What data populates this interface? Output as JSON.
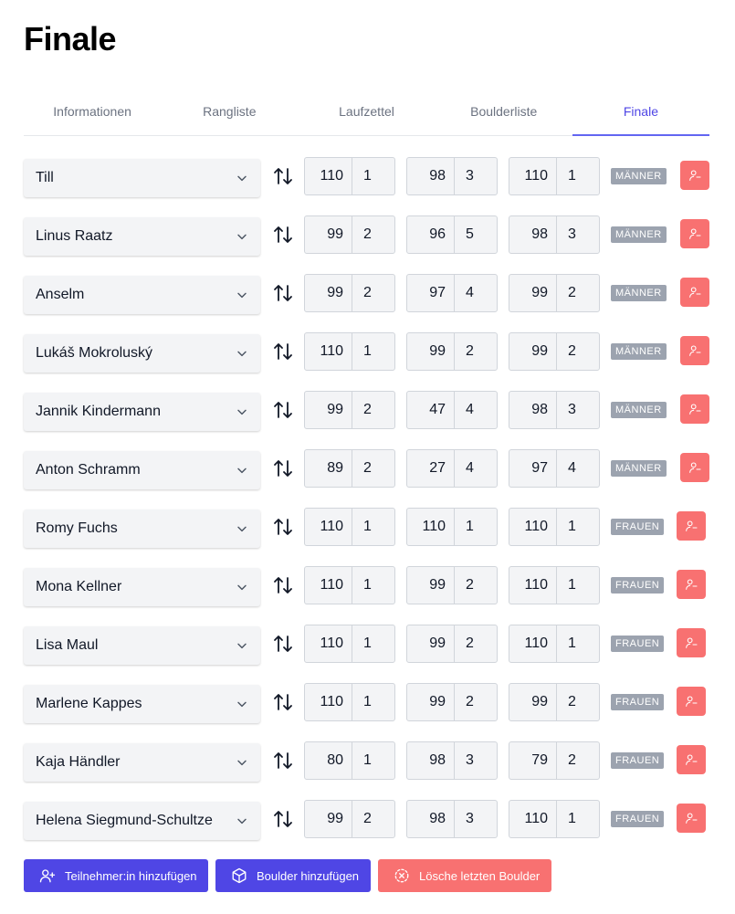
{
  "page": {
    "title": "Finale"
  },
  "tabs": [
    {
      "label": "Informationen",
      "active": false
    },
    {
      "label": "Rangliste",
      "active": false
    },
    {
      "label": "Laufzettel",
      "active": false
    },
    {
      "label": "Boulderliste",
      "active": false
    },
    {
      "label": "Finale",
      "active": true
    }
  ],
  "participants": [
    {
      "name": "Till",
      "category": "MÄNNER",
      "boulders": [
        {
          "points": "110",
          "rank": "1"
        },
        {
          "points": "98",
          "rank": "3"
        },
        {
          "points": "110",
          "rank": "1"
        }
      ]
    },
    {
      "name": "Linus Raatz",
      "category": "MÄNNER",
      "boulders": [
        {
          "points": "99",
          "rank": "2"
        },
        {
          "points": "96",
          "rank": "5"
        },
        {
          "points": "98",
          "rank": "3"
        }
      ]
    },
    {
      "name": "Anselm",
      "category": "MÄNNER",
      "boulders": [
        {
          "points": "99",
          "rank": "2"
        },
        {
          "points": "97",
          "rank": "4"
        },
        {
          "points": "99",
          "rank": "2"
        }
      ]
    },
    {
      "name": "Lukáš Mokroluský",
      "category": "MÄNNER",
      "boulders": [
        {
          "points": "110",
          "rank": "1"
        },
        {
          "points": "99",
          "rank": "2"
        },
        {
          "points": "99",
          "rank": "2"
        }
      ]
    },
    {
      "name": "Jannik Kindermann",
      "category": "MÄNNER",
      "boulders": [
        {
          "points": "99",
          "rank": "2"
        },
        {
          "points": "47",
          "rank": "4"
        },
        {
          "points": "98",
          "rank": "3"
        }
      ]
    },
    {
      "name": "Anton Schramm",
      "category": "MÄNNER",
      "boulders": [
        {
          "points": "89",
          "rank": "2"
        },
        {
          "points": "27",
          "rank": "4"
        },
        {
          "points": "97",
          "rank": "4"
        }
      ]
    },
    {
      "name": "Romy Fuchs",
      "category": "FRAUEN",
      "boulders": [
        {
          "points": "110",
          "rank": "1"
        },
        {
          "points": "110",
          "rank": "1"
        },
        {
          "points": "110",
          "rank": "1"
        }
      ]
    },
    {
      "name": "Mona Kellner",
      "category": "FRAUEN",
      "boulders": [
        {
          "points": "110",
          "rank": "1"
        },
        {
          "points": "99",
          "rank": "2"
        },
        {
          "points": "110",
          "rank": "1"
        }
      ]
    },
    {
      "name": "Lisa Maul",
      "category": "FRAUEN",
      "boulders": [
        {
          "points": "110",
          "rank": "1"
        },
        {
          "points": "99",
          "rank": "2"
        },
        {
          "points": "110",
          "rank": "1"
        }
      ]
    },
    {
      "name": "Marlene Kappes",
      "category": "FRAUEN",
      "boulders": [
        {
          "points": "110",
          "rank": "1"
        },
        {
          "points": "99",
          "rank": "2"
        },
        {
          "points": "99",
          "rank": "2"
        }
      ]
    },
    {
      "name": "Kaja Händler",
      "category": "FRAUEN",
      "boulders": [
        {
          "points": "80",
          "rank": "1"
        },
        {
          "points": "98",
          "rank": "3"
        },
        {
          "points": "79",
          "rank": "2"
        }
      ]
    },
    {
      "name": "Helena Siegmund-Schultze",
      "category": "FRAUEN",
      "boulders": [
        {
          "points": "99",
          "rank": "2"
        },
        {
          "points": "98",
          "rank": "3"
        },
        {
          "points": "110",
          "rank": "1"
        }
      ]
    }
  ],
  "actions": {
    "add_participant": "Teilnehmer:in hinzufügen",
    "add_boulder": "Boulder hinzufügen",
    "delete_last_boulder": "Lösche letzten Boulder"
  },
  "colors": {
    "primary": "#4f46e5",
    "danger": "#f87171",
    "badge": "#9ca3af"
  },
  "icons": {
    "row_dropdown": "chevron-down-icon",
    "row_swap": "swap-arrows-icon",
    "row_remove": "user-remove-icon",
    "add_participant": "user-plus-icon",
    "add_boulder": "cube-icon",
    "delete_boulder": "dashed-circle-x-icon"
  }
}
